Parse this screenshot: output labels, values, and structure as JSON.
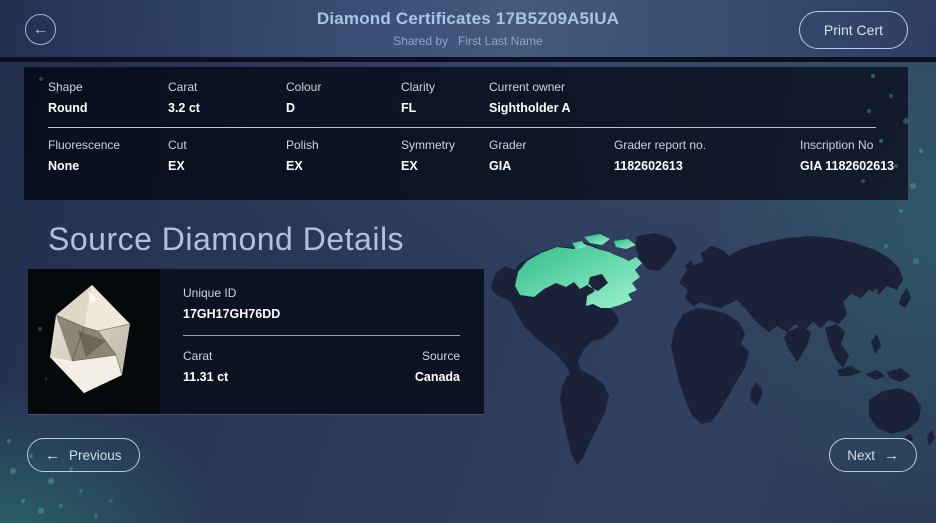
{
  "header": {
    "title": "Diamond Certificates 17B5Z09A5IUA",
    "shared_by_label": "Shared by",
    "shared_by_name": "First Last Name",
    "print_button_label": "Print Cert",
    "back_icon_glyph": "←"
  },
  "certificate": {
    "row1": [
      {
        "label": "Shape",
        "value": "Round"
      },
      {
        "label": "Carat",
        "value": "3.2 ct"
      },
      {
        "label": "Colour",
        "value": "D"
      },
      {
        "label": "Clarity",
        "value": "FL"
      },
      {
        "label": "Current owner",
        "value": "Sightholder A"
      }
    ],
    "row2": [
      {
        "label": "Fluorescence",
        "value": "None"
      },
      {
        "label": "Cut",
        "value": "EX"
      },
      {
        "label": "Polish",
        "value": "EX"
      },
      {
        "label": "Symmetry",
        "value": "EX"
      },
      {
        "label": "Grader",
        "value": "GIA"
      },
      {
        "label": "Grader report no.",
        "value": "1182602613"
      },
      {
        "label": "Inscription No",
        "value": "GIA 1182602613"
      }
    ]
  },
  "source_section": {
    "heading": "Source Diamond Details",
    "card": {
      "image_name": "rough-diamond-photo",
      "unique_id_label": "Unique ID",
      "unique_id_value": "17GH17GH76DD",
      "carat_label": "Carat",
      "carat_value": "11.31 ct",
      "source_label": "Source",
      "source_value": "Canada"
    },
    "map": {
      "type": "world-map",
      "highlighted_country": "Canada",
      "highlight_color": "#63dfae",
      "landmass_color": "#1a2138"
    }
  },
  "pagination": {
    "previous_label": "Previous",
    "next_label": "Next",
    "prev_icon_glyph": "←",
    "next_icon_glyph": "→"
  },
  "colors": {
    "accent_text": "#a9c4e6",
    "label_text": "#c9d4e2",
    "value_text": "#ffffff",
    "button_border": "#b8cbe4"
  }
}
